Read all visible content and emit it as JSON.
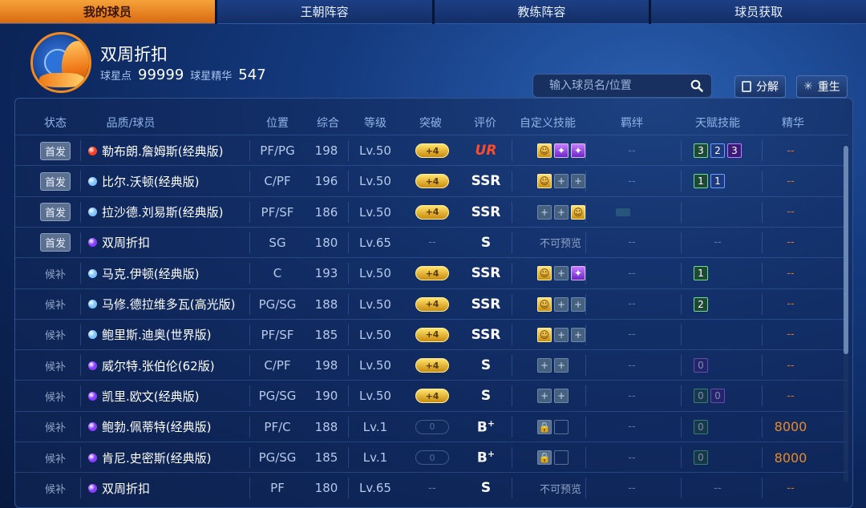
{
  "tabs": [
    "我的球员",
    "王朝阵容",
    "教练阵容",
    "球员获取"
  ],
  "header": {
    "player_name": "双周折扣",
    "star_points_label": "球星点",
    "star_points_value": "99999",
    "essence_label": "球星精华",
    "essence_value": "547"
  },
  "search": {
    "placeholder": "输入球员名/位置"
  },
  "buttons": {
    "decompose": "分解",
    "rebirth": "重生"
  },
  "columns": [
    "状态",
    "品质/球员",
    "位置",
    "综合",
    "等级",
    "突破",
    "评价",
    "自定义技能",
    "羁绊",
    "天赋技能",
    "精华"
  ],
  "colors": {
    "accent": "#f28a1e",
    "quality_red": "#ff3b1f",
    "quality_blue": "#7fc6ff",
    "quality_purple": "#8a3cff"
  },
  "rows": [
    {
      "status": "首发",
      "quality": "red",
      "name": "勒布朗.詹姆斯(经典版)",
      "position": "PF/PG",
      "overall": "198",
      "level": "Lv.50",
      "breakthrough": "+4",
      "rating": "UR",
      "skills": [
        "gold",
        "purple",
        "purple"
      ],
      "bond": "--",
      "talents": [
        {
          "v": "3",
          "c": "green"
        },
        {
          "v": "2",
          "c": "blue"
        },
        {
          "v": "3",
          "c": "purple"
        }
      ],
      "essence": "--"
    },
    {
      "status": "首发",
      "quality": "blue",
      "name": "比尔.沃顿(经典版)",
      "position": "C/PF",
      "overall": "196",
      "level": "Lv.50",
      "breakthrough": "+4",
      "rating": "SSR",
      "skills": [
        "gold",
        "empty",
        "empty"
      ],
      "bond": "--",
      "talents": [
        {
          "v": "1",
          "c": "green"
        },
        {
          "v": "1",
          "c": "blue"
        }
      ],
      "essence": "--"
    },
    {
      "status": "首发",
      "quality": "blue",
      "name": "拉沙德.刘易斯(经典版)",
      "position": "PF/SF",
      "overall": "186",
      "level": "Lv.50",
      "breakthrough": "+4",
      "rating": "SSR",
      "skills": [
        "empty",
        "empty",
        "gold"
      ],
      "bond": "",
      "talents": [],
      "essence": "--"
    },
    {
      "status": "首发",
      "quality": "purple",
      "name": "双周折扣",
      "position": "SG",
      "overall": "180",
      "level": "Lv.65",
      "breakthrough": "--",
      "rating": "S",
      "skills": [],
      "skills_text": "不可预览",
      "bond": "--",
      "talents_text": "--",
      "essence": "--"
    },
    {
      "status": "候补",
      "quality": "blue",
      "name": "马克.伊顿(经典版)",
      "position": "C",
      "overall": "193",
      "level": "Lv.50",
      "breakthrough": "+4",
      "rating": "SSR",
      "skills": [
        "gold",
        "empty",
        "purple"
      ],
      "bond": "--",
      "talents": [
        {
          "v": "1",
          "c": "green"
        }
      ],
      "essence": "--"
    },
    {
      "status": "候补",
      "quality": "blue",
      "name": "马修.德拉维多瓦(高光版)",
      "position": "PG/SG",
      "overall": "188",
      "level": "Lv.50",
      "breakthrough": "+4",
      "rating": "SSR",
      "skills": [
        "gold",
        "empty",
        "empty"
      ],
      "bond": "--",
      "talents": [
        {
          "v": "2",
          "c": "green"
        }
      ],
      "essence": "--"
    },
    {
      "status": "候补",
      "quality": "blue",
      "name": "鲍里斯.迪奥(世界版)",
      "position": "PF/SF",
      "overall": "185",
      "level": "Lv.50",
      "breakthrough": "+4",
      "rating": "SSR",
      "skills": [
        "gold",
        "empty",
        "empty"
      ],
      "bond": "--",
      "talents": [],
      "essence": "--"
    },
    {
      "status": "候补",
      "quality": "purple",
      "name": "威尔特.张伯伦(62版)",
      "position": "C/PF",
      "overall": "198",
      "level": "Lv.50",
      "breakthrough": "+4",
      "rating": "S",
      "skills": [
        "empty",
        "empty"
      ],
      "bond": "--",
      "talents": [
        {
          "v": "0",
          "c": "purple",
          "dim": true
        }
      ],
      "essence": "--"
    },
    {
      "status": "候补",
      "quality": "purple",
      "name": "凯里.欧文(经典版)",
      "position": "PG/SG",
      "overall": "190",
      "level": "Lv.50",
      "breakthrough": "+4",
      "rating": "S",
      "skills": [
        "empty",
        "empty"
      ],
      "bond": "--",
      "talents": [
        {
          "v": "0",
          "c": "green",
          "dim": true
        },
        {
          "v": "0",
          "c": "purple",
          "dim": true
        }
      ],
      "essence": "--"
    },
    {
      "status": "候补",
      "quality": "purple",
      "name": "鲍勃.佩蒂特(经典版)",
      "position": "PF/C",
      "overall": "188",
      "level": "Lv.1",
      "breakthrough": "0",
      "rating": "B",
      "rating_sup": "+",
      "skills": [
        "lock",
        "blank"
      ],
      "bond": "--",
      "talents": [
        {
          "v": "0",
          "c": "green",
          "dim": true
        }
      ],
      "essence": "8000"
    },
    {
      "status": "候补",
      "quality": "purple",
      "name": "肯尼.史密斯(经典版)",
      "position": "PG/SG",
      "overall": "185",
      "level": "Lv.1",
      "breakthrough": "0",
      "rating": "B",
      "rating_sup": "+",
      "skills": [
        "lock",
        "blank"
      ],
      "bond": "--",
      "talents": [
        {
          "v": "0",
          "c": "green",
          "dim": true
        }
      ],
      "essence": "8000"
    },
    {
      "status": "候补",
      "quality": "purple",
      "name": "双周折扣",
      "position": "PF",
      "overall": "180",
      "level": "Lv.65",
      "breakthrough": "--",
      "rating": "S",
      "skills": [],
      "skills_text": "不可预览",
      "bond": "--",
      "talents_text": "--",
      "essence": "--"
    }
  ]
}
